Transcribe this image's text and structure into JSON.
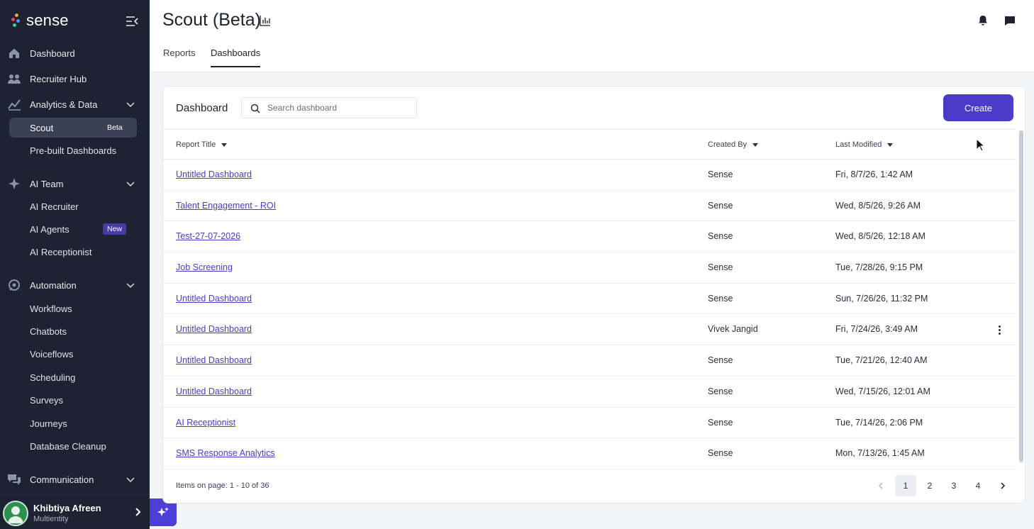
{
  "brand": {
    "name": "sense"
  },
  "sidebar": {
    "items": [
      {
        "label": "Dashboard",
        "icon": "home-icon"
      },
      {
        "label": "Recruiter Hub",
        "icon": "people-icon"
      },
      {
        "label": "Analytics & Data",
        "icon": "analytics-icon"
      },
      {
        "label": "Scout",
        "badge": "Beta"
      },
      {
        "label": "Pre-built Dashboards"
      },
      {
        "label": "AI Team",
        "icon": "sparkle-icon"
      },
      {
        "label": "AI Recruiter"
      },
      {
        "label": "AI Agents",
        "badge": "New"
      },
      {
        "label": "AI Receptionist"
      },
      {
        "label": "Automation",
        "icon": "automation-icon"
      },
      {
        "label": "Workflows"
      },
      {
        "label": "Chatbots"
      },
      {
        "label": "Voiceflows"
      },
      {
        "label": "Scheduling"
      },
      {
        "label": "Surveys"
      },
      {
        "label": "Journeys"
      },
      {
        "label": "Database Cleanup"
      },
      {
        "label": "Communication",
        "icon": "communication-icon"
      }
    ]
  },
  "user": {
    "name": "Khibtiya Afreen",
    "role": "Multientity"
  },
  "header": {
    "title": "Scout (Beta)",
    "tabs": [
      {
        "label": "Reports"
      },
      {
        "label": "Dashboards"
      }
    ]
  },
  "card": {
    "title": "Dashboard",
    "search_placeholder": "Search dashboard",
    "create_label": "Create"
  },
  "table": {
    "columns": [
      "Report Title",
      "Created By",
      "Last Modified"
    ],
    "rows": [
      {
        "title": "Untitled Dashboard",
        "created_by": "Sense",
        "last_modified": "Fri, 8/7/26, 1:42 AM"
      },
      {
        "title": "Talent Engagement - ROI",
        "created_by": "Sense",
        "last_modified": "Wed, 8/5/26, 9:26 AM"
      },
      {
        "title": "Test-27-07-2026",
        "created_by": "Sense",
        "last_modified": "Wed, 8/5/26, 12:18 AM"
      },
      {
        "title": "Job Screening",
        "created_by": "Sense",
        "last_modified": "Tue, 7/28/26, 9:15 PM"
      },
      {
        "title": "Untitled Dashboard",
        "created_by": "Sense",
        "last_modified": "Sun, 7/26/26, 11:32 PM"
      },
      {
        "title": "Untitled Dashboard",
        "created_by": "Vivek Jangid",
        "last_modified": "Fri, 7/24/26, 3:49 AM"
      },
      {
        "title": "Untitled Dashboard",
        "created_by": "Sense",
        "last_modified": "Tue, 7/21/26, 12:40 AM"
      },
      {
        "title": "Untitled Dashboard",
        "created_by": "Sense",
        "last_modified": "Wed, 7/15/26, 12:01 AM"
      },
      {
        "title": "AI Receptionist",
        "created_by": "Sense",
        "last_modified": "Tue, 7/14/26, 2:06 PM"
      },
      {
        "title": "SMS Response Analytics",
        "created_by": "Sense",
        "last_modified": "Mon, 7/13/26, 1:45 AM"
      }
    ]
  },
  "pagination": {
    "summary": "Items on page: 1 - 10 of 36",
    "pages": [
      "1",
      "2",
      "3",
      "4"
    ],
    "current": "1"
  },
  "colors": {
    "accent": "#4b3bc9",
    "sidebar_bg": "#1d2333",
    "link": "#4b3bc9"
  }
}
